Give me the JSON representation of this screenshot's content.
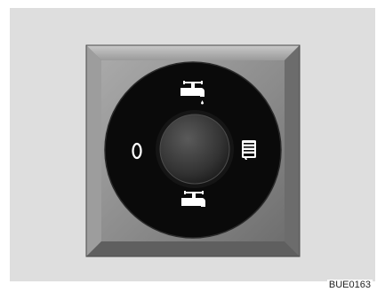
{
  "figure": {
    "reference_code": "BUE0163",
    "background_color": "#dedede",
    "switch": {
      "type": "rotary-selector",
      "plate_color": "#8a8a8a",
      "dial_color": "#0a0a0a",
      "knob_color": "#3a3a3a",
      "positions": [
        {
          "name": "off",
          "label": "0",
          "icon": "off-symbol"
        },
        {
          "name": "top",
          "label": "",
          "icon": "faucet-icon"
        },
        {
          "name": "right",
          "label": "",
          "icon": "heater-tank-icon"
        },
        {
          "name": "bottom",
          "label": "",
          "icon": "faucet-icon"
        }
      ]
    }
  }
}
